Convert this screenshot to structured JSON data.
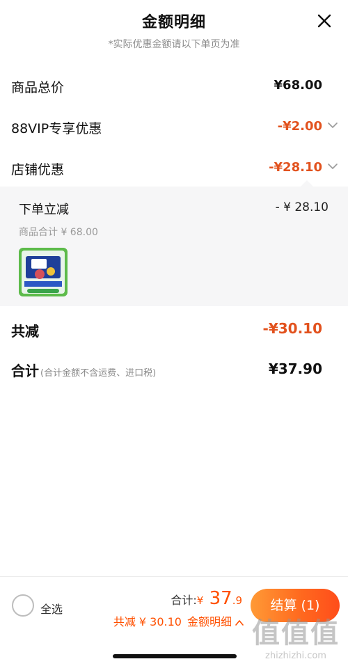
{
  "header": {
    "title": "金额明细",
    "subtitle": "*实际优惠金额请以下单页为准",
    "close_icon": "close-icon"
  },
  "rows": {
    "goods_total": {
      "label": "商品总价",
      "value": "¥68.00"
    },
    "vip_discount": {
      "label": "88VIP专享优惠",
      "value": "-¥2.00"
    },
    "store_discount": {
      "label": "店铺优惠",
      "value": "-¥28.10"
    }
  },
  "detail": {
    "title": "下单立减",
    "amount": "- ¥ 28.10",
    "subtotal": "商品合计 ¥ 68.00",
    "thumbnail_icon": "product-thumbnail"
  },
  "summary": {
    "total_reduction_label": "共减",
    "total_reduction_value": "-¥30.10",
    "grand_total_label": "合计",
    "grand_total_note": "(合计金额不含运费、进口税)",
    "grand_total_value": "¥37.90"
  },
  "bottom_bar": {
    "select_all": "全选",
    "total_label": "合计:",
    "currency": "¥",
    "total_int": " 37",
    "total_dec": ".9",
    "saving_text": "共减 ¥ 30.10",
    "detail_link": "金额明细",
    "checkout_label": "结算 (1)",
    "watermark_text": "值值值",
    "watermark_url": "zhizhizhi.com"
  },
  "colors": {
    "accent_orange": "#e2521e",
    "checkout_start": "#ff9a36",
    "checkout_end": "#ff4d1a",
    "panel_bg": "#f6f6f7"
  }
}
